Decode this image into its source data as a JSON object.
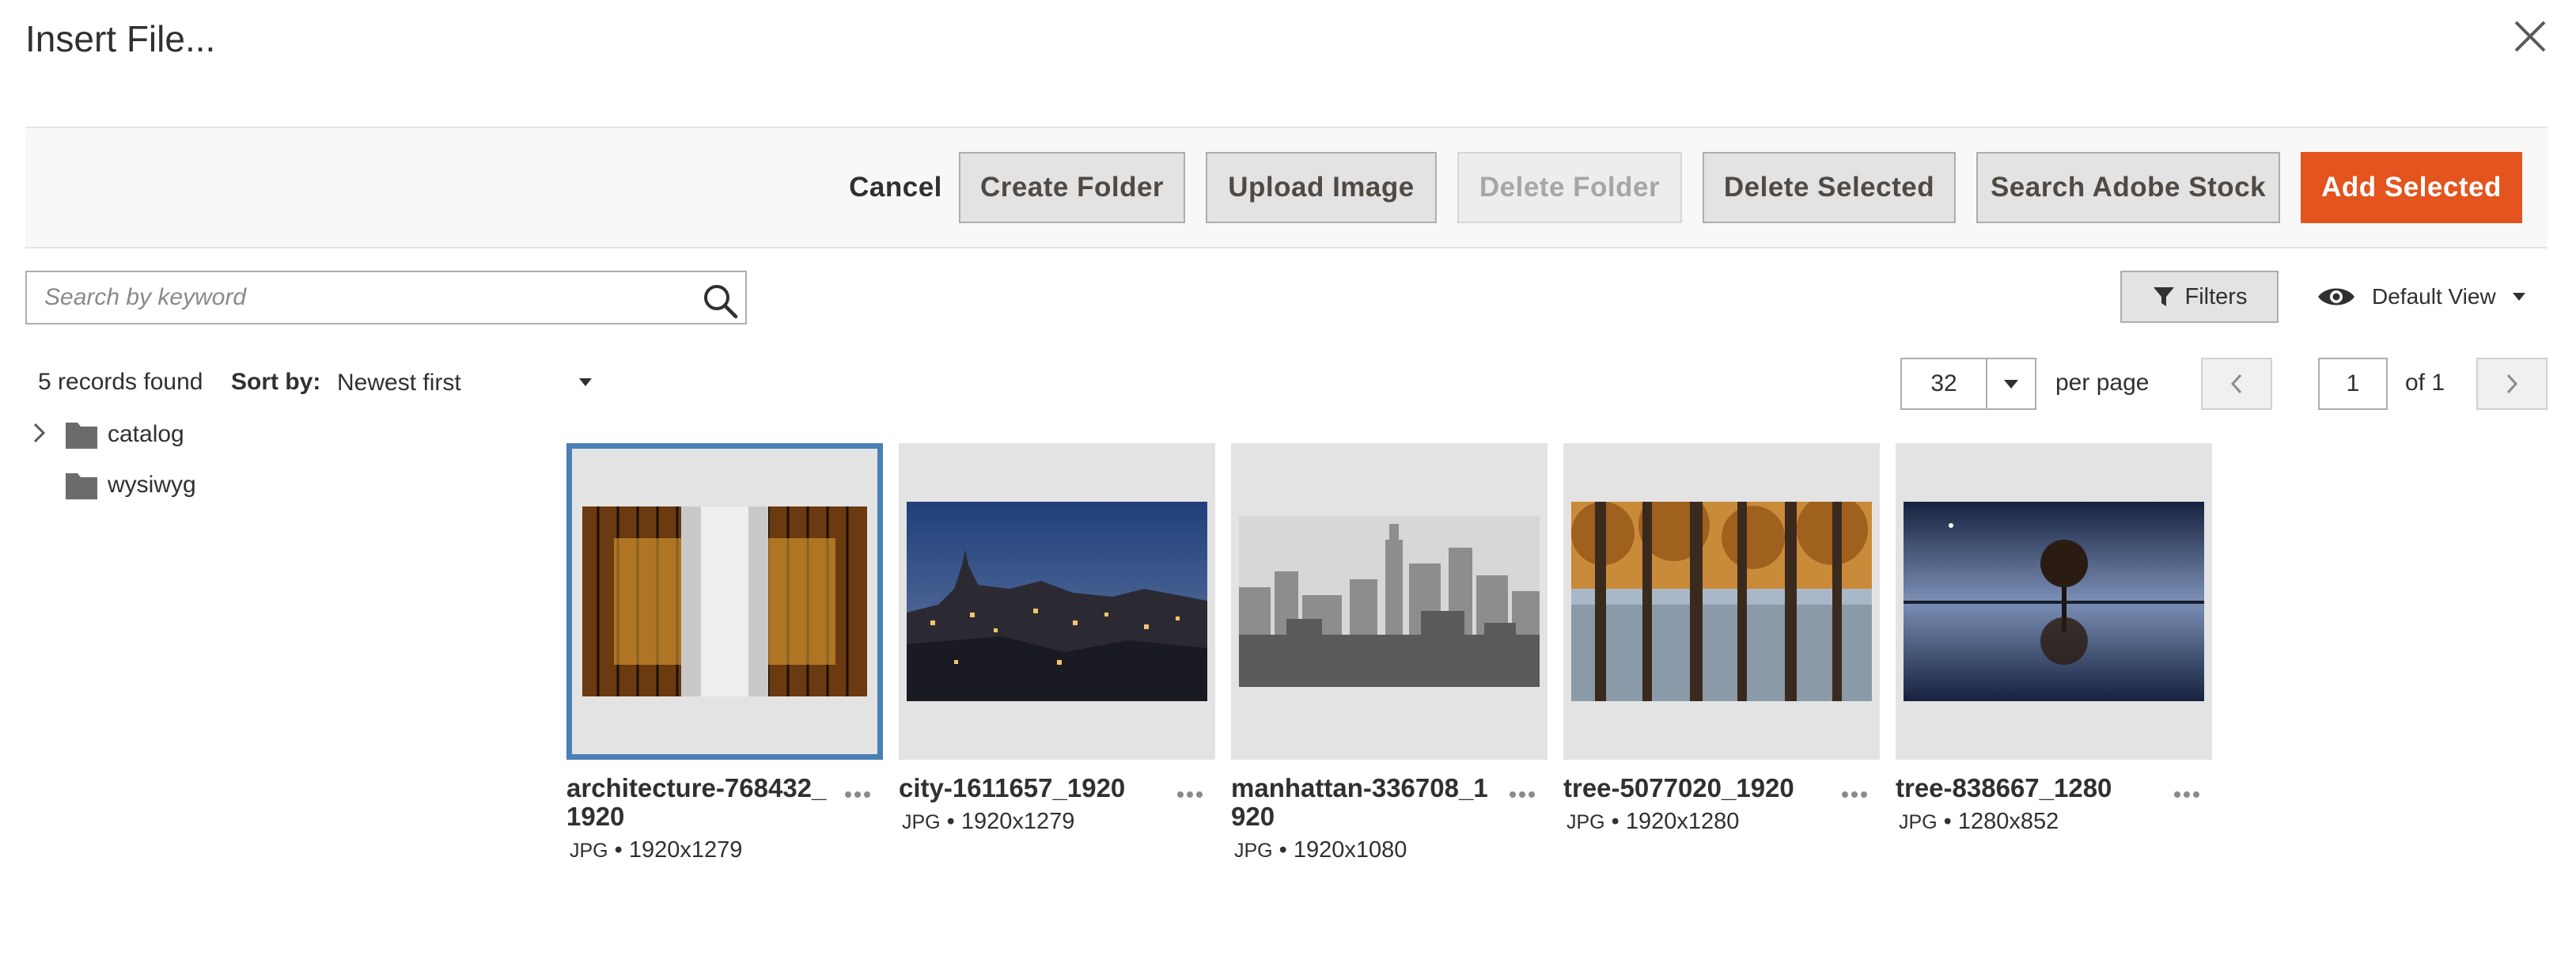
{
  "modal": {
    "title": "Insert File..."
  },
  "toolbar": {
    "cancel": "Cancel",
    "create_folder": "Create Folder",
    "upload_image": "Upload Image",
    "delete_folder": "Delete Folder",
    "delete_selected": "Delete Selected",
    "search_stock": "Search Adobe Stock",
    "add_selected": "Add Selected"
  },
  "search": {
    "placeholder": "Search by keyword",
    "value": ""
  },
  "filters": {
    "label": "Filters"
  },
  "view": {
    "label": "Default View"
  },
  "records": {
    "text": "5 records found"
  },
  "sort": {
    "label": "Sort by:",
    "value": "Newest first"
  },
  "pagination": {
    "per_page_value": "32",
    "per_page_label": "per page",
    "current_page": "1",
    "of_label": "of 1"
  },
  "tree": {
    "items": [
      {
        "label": "catalog",
        "icon": "folder-icon",
        "expandable": true
      },
      {
        "label": "wysiwyg",
        "icon": "folder-icon",
        "expandable": false
      }
    ]
  },
  "images": [
    {
      "name": "architecture-768432_1920",
      "format": "JPG",
      "dimensions": "1920x1279",
      "selected": true
    },
    {
      "name": "city-1611657_1920",
      "format": "JPG",
      "dimensions": "1920x1279",
      "selected": false
    },
    {
      "name": "manhattan-336708_1920",
      "format": "JPG",
      "dimensions": "1920x1080",
      "selected": false
    },
    {
      "name": "tree-5077020_1920",
      "format": "JPG",
      "dimensions": "1920x1280",
      "selected": false
    },
    {
      "name": "tree-838667_1280",
      "format": "JPG",
      "dimensions": "1280x852",
      "selected": false
    }
  ],
  "colors": {
    "primary": "#e3541e",
    "selection": "#4a7fb5",
    "toolbar_bg": "#f8f8f8",
    "tile_bg": "#e3e3e3"
  }
}
